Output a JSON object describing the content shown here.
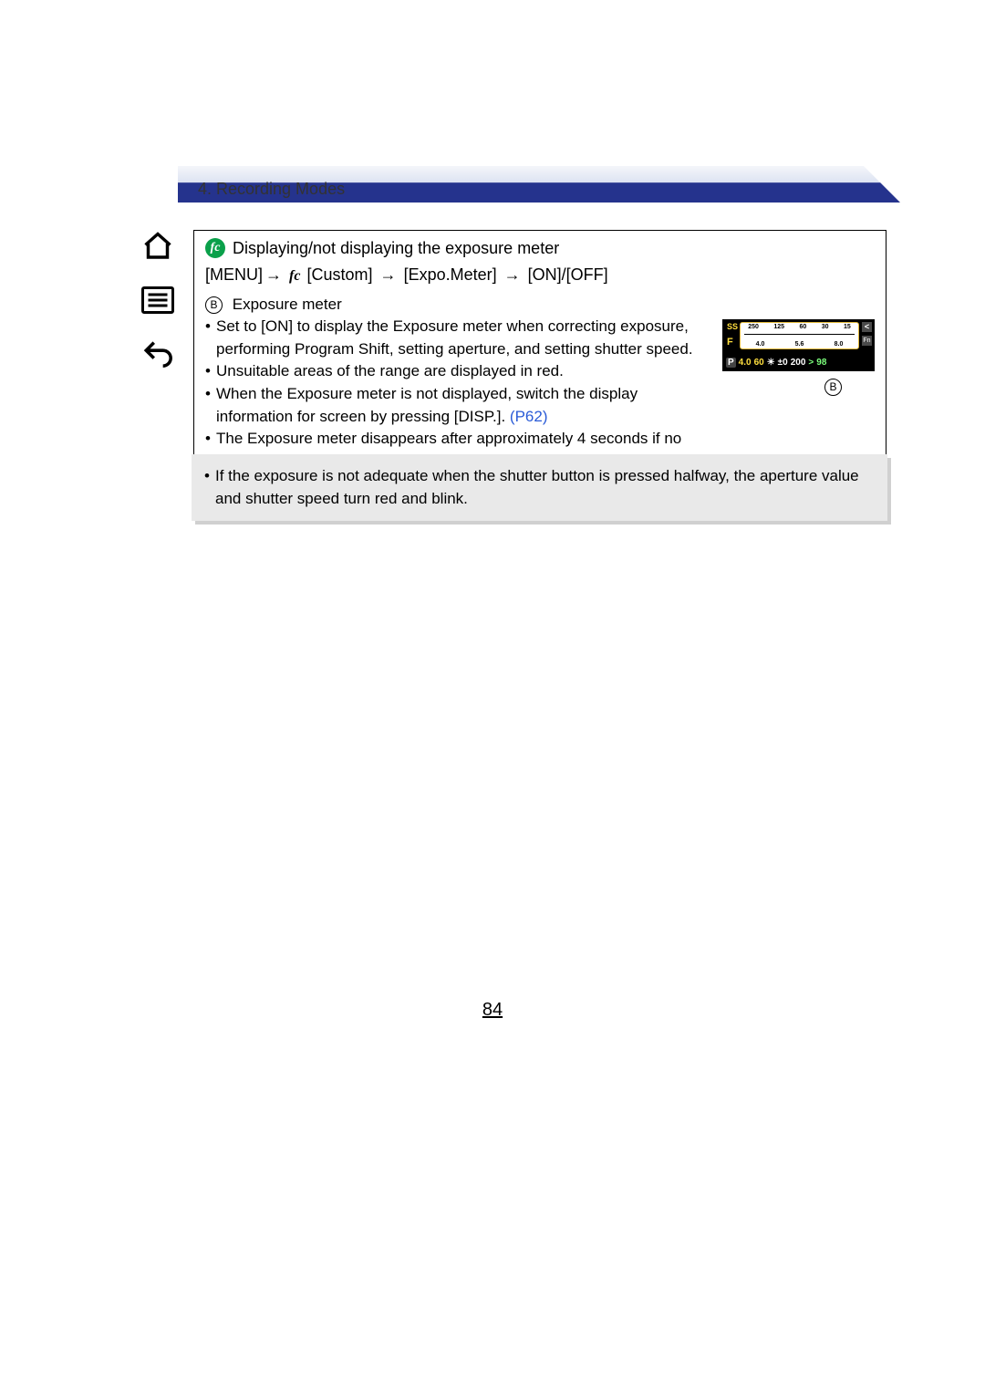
{
  "header": {
    "breadcrumb": "4. Recording Modes"
  },
  "sidebar": {
    "home_icon": "home-icon",
    "menu_icon": "menu-icon",
    "back_icon": "back-icon"
  },
  "section": {
    "badge": "fc",
    "title": "Displaying/not displaying the exposure meter",
    "menu_path": {
      "menu": "MENU",
      "custom_icon": "fc",
      "custom_label": "[Custom]",
      "expo_label": "[Expo.Meter]",
      "onoff": "[ON]/[OFF]"
    },
    "label_letter": "B",
    "label_text": "Exposure meter",
    "bullets": [
      "Set to [ON] to display the Exposure meter when correcting exposure, performing Program Shift, setting aperture, and setting shutter speed.",
      "Unsuitable areas of the range are displayed in red.",
      "When the Exposure meter is not displayed, switch the display information for screen by pressing [DISP.].",
      "The Exposure meter disappears after approximately 4 seconds if no operation is performed."
    ],
    "p62_ref": "(P62)",
    "callout_letter": "B",
    "screen": {
      "ss_label": "SS",
      "f_label": "F",
      "ss_values": [
        "250",
        "125",
        "60",
        "30",
        "15"
      ],
      "f_values": [
        "4.0",
        "5.6",
        "8.0"
      ],
      "right_arrow": "<",
      "right_fn": "Fn",
      "bottom_mode": "P",
      "bottom_fvalue": "4.0",
      "bottom_shutter": "60",
      "bottom_ev": "±0",
      "bottom_iso": "200",
      "bottom_chev": ">",
      "bottom_count": "98"
    }
  },
  "grey_note": "If the exposure is not adequate when the shutter button is pressed halfway, the aperture value and shutter speed turn red and blink.",
  "page_number": "84"
}
